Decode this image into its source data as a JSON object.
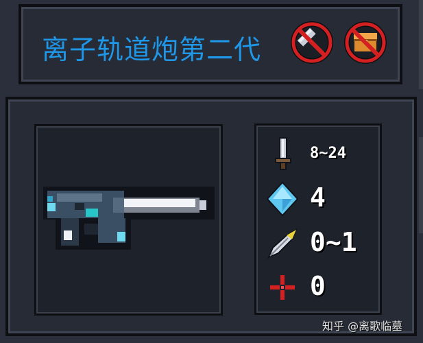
{
  "item": {
    "name": "离子轨道炮第二代"
  },
  "restrictions": [
    {
      "icon": "no-hammer-icon"
    },
    {
      "icon": "no-chest-icon"
    }
  ],
  "stats": [
    {
      "icon": "sword-icon",
      "label": "damage",
      "value": "8~24"
    },
    {
      "icon": "diamond-icon",
      "label": "energy",
      "value": "4"
    },
    {
      "icon": "feather-icon",
      "label": "precision",
      "value": "0~1"
    },
    {
      "icon": "crosshair-icon",
      "label": "crit",
      "value": "0"
    }
  ],
  "colors": {
    "title": "#1f96e6",
    "panel": "#262b36",
    "ban": "#d42020"
  },
  "watermark": {
    "text": "知乎 @离歌临墓"
  }
}
